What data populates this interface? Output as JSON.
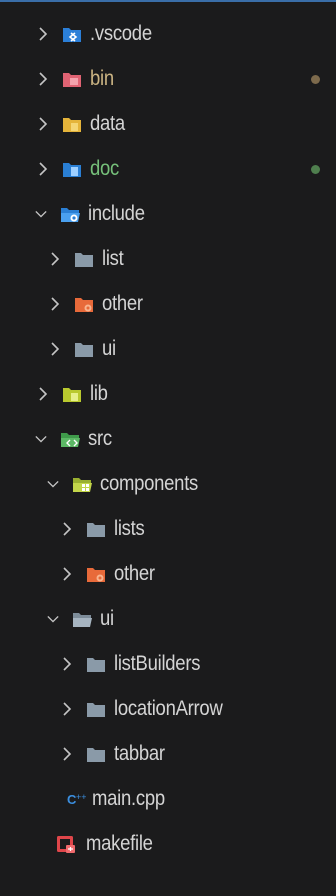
{
  "explorer": {
    "items": [
      {
        "label": ".vscode",
        "icon": "vscode-folder-icon",
        "status": "normal"
      },
      {
        "label": "bin",
        "icon": "bin-folder-icon",
        "status": "modified",
        "dot_color": "#7d6a4c"
      },
      {
        "label": "data",
        "icon": "data-folder-icon",
        "status": "normal"
      },
      {
        "label": "doc",
        "icon": "doc-folder-icon",
        "status": "untracked",
        "dot_color": "#4f7f4e"
      },
      {
        "label": "include",
        "icon": "include-folder-open-icon",
        "status": "normal"
      },
      {
        "label": "list",
        "icon": "folder-icon",
        "status": "normal"
      },
      {
        "label": "other",
        "icon": "other-folder-icon",
        "status": "normal"
      },
      {
        "label": "ui",
        "icon": "folder-icon",
        "status": "normal"
      },
      {
        "label": "lib",
        "icon": "lib-folder-icon",
        "status": "normal"
      },
      {
        "label": "src",
        "icon": "src-folder-open-icon",
        "status": "normal"
      },
      {
        "label": "components",
        "icon": "components-folder-open-icon",
        "status": "normal"
      },
      {
        "label": "lists",
        "icon": "folder-icon",
        "status": "normal"
      },
      {
        "label": "other",
        "icon": "other-folder-icon",
        "status": "normal"
      },
      {
        "label": "ui",
        "icon": "folder-open-icon",
        "status": "normal"
      },
      {
        "label": "listBuilders",
        "icon": "folder-icon",
        "status": "normal"
      },
      {
        "label": "locationArrow",
        "icon": "folder-icon",
        "status": "normal"
      },
      {
        "label": "tabbar",
        "icon": "folder-icon",
        "status": "normal"
      },
      {
        "label": "main.cpp",
        "icon": "cpp-file-icon",
        "status": "normal"
      },
      {
        "label": "makefile",
        "icon": "makefile-icon",
        "status": "normal"
      }
    ]
  },
  "colors": {
    "background": "#1b1b1c",
    "text": "#d4d4d4",
    "modified_text": "#cbb483",
    "untracked_text": "#76c07a",
    "chevron": "#c5c5c5"
  }
}
